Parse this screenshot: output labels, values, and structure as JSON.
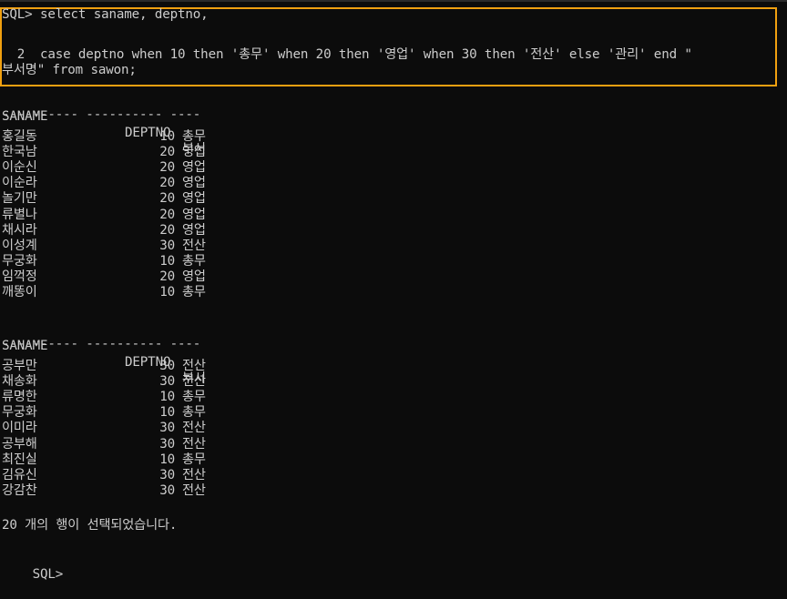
{
  "prompt": "SQL>",
  "query": {
    "line1": "SQL> select saname, deptno,",
    "line2": "  2  case deptno when 10 then '총무' when 20 then '영업' when 30 then '전산' else '관리' end \"",
    "line3": "부서명\" from sawon;"
  },
  "headers": {
    "saname": "SANAME",
    "deptno": "DEPTNO",
    "dept": "부서",
    "separator": "---------- ---------- ----"
  },
  "page1": [
    {
      "saname": "홍길동",
      "deptno": "10",
      "dept": "총무"
    },
    {
      "saname": "한국남",
      "deptno": "20",
      "dept": "영업"
    },
    {
      "saname": "이순신",
      "deptno": "20",
      "dept": "영업"
    },
    {
      "saname": "이순라",
      "deptno": "20",
      "dept": "영업"
    },
    {
      "saname": "놀기만",
      "deptno": "20",
      "dept": "영업"
    },
    {
      "saname": "류별나",
      "deptno": "20",
      "dept": "영업"
    },
    {
      "saname": "채시라",
      "deptno": "20",
      "dept": "영업"
    },
    {
      "saname": "이성계",
      "deptno": "30",
      "dept": "전산"
    },
    {
      "saname": "무궁화",
      "deptno": "10",
      "dept": "총무"
    },
    {
      "saname": "임꺽정",
      "deptno": "20",
      "dept": "영업"
    },
    {
      "saname": "깨똥이",
      "deptno": "10",
      "dept": "총무"
    }
  ],
  "page2": [
    {
      "saname": "공부만",
      "deptno": "30",
      "dept": "전산"
    },
    {
      "saname": "채송화",
      "deptno": "30",
      "dept": "전산"
    },
    {
      "saname": "류명한",
      "deptno": "10",
      "dept": "총무"
    },
    {
      "saname": "무궁화",
      "deptno": "10",
      "dept": "총무"
    },
    {
      "saname": "이미라",
      "deptno": "30",
      "dept": "전산"
    },
    {
      "saname": "공부해",
      "deptno": "30",
      "dept": "전산"
    },
    {
      "saname": "최진실",
      "deptno": "10",
      "dept": "총무"
    },
    {
      "saname": "김유신",
      "deptno": "30",
      "dept": "전산"
    },
    {
      "saname": "강감찬",
      "deptno": "30",
      "dept": "전산"
    }
  ],
  "summary": "20 개의 행이 선택되었습니다.",
  "final_prompt": "SQL>",
  "colors": {
    "background": "#0c0c0c",
    "text": "#cccccc",
    "highlight": "#f0a010"
  }
}
